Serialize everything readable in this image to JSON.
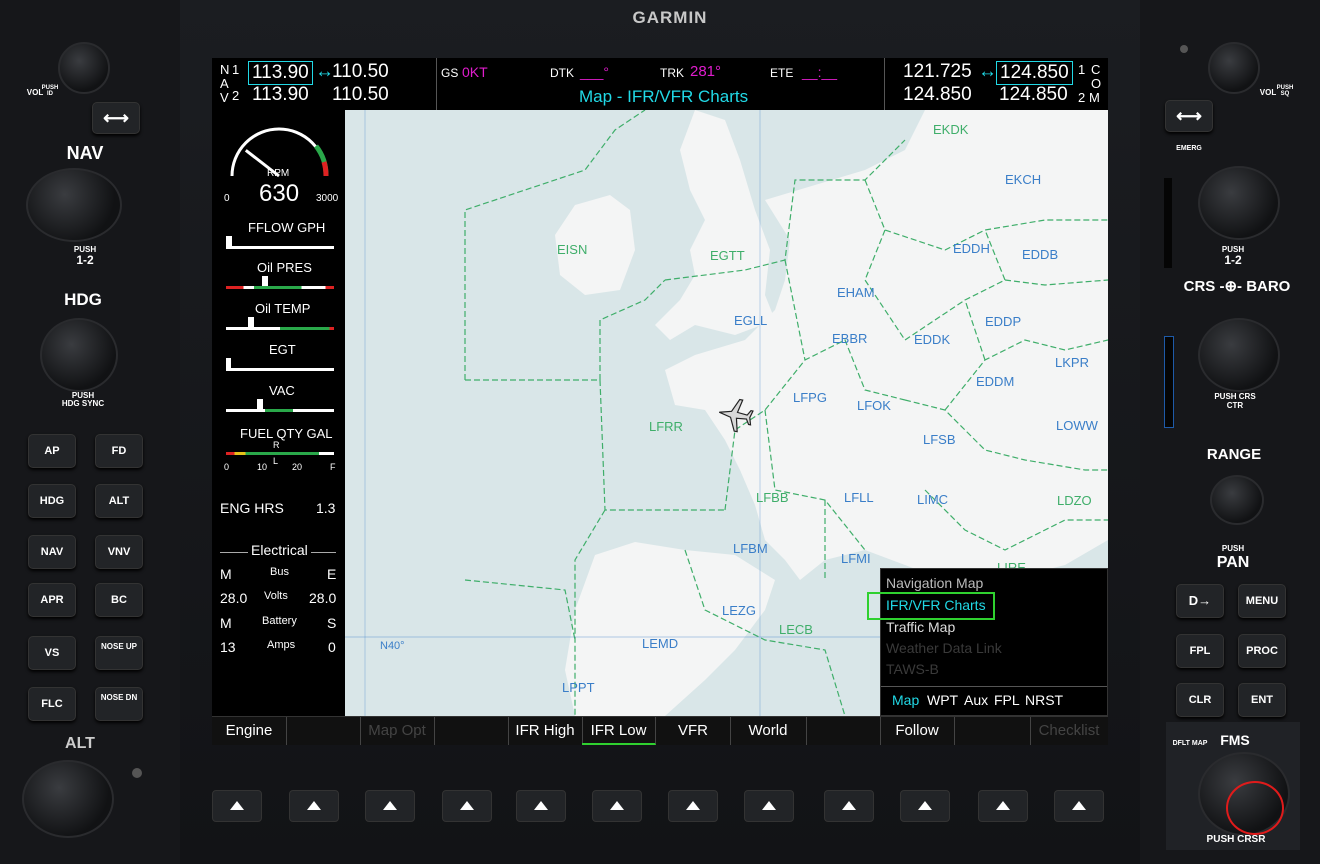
{
  "brand": "GARMIN",
  "nav": {
    "label_n": "N",
    "label_a": "A",
    "label_v": "V",
    "idx1": "1",
    "idx2": "2",
    "nav1_active": "113.90",
    "nav1_standby": "110.50",
    "nav2_active": "113.90",
    "nav2_standby": "110.50",
    "swap_arrow": "↔"
  },
  "data_fields": {
    "gs_label": "GS",
    "gs_value": "0KT",
    "dtk_label": "DTK",
    "dtk_value": "___°",
    "trk_label": "TRK",
    "trk_value": "281°",
    "ete_label": "ETE",
    "ete_value": "__:__"
  },
  "page_title": "Map - IFR/VFR Charts",
  "com": {
    "com1_active": "121.725",
    "com1_standby": "124.850",
    "com2_active": "124.850",
    "com2_standby": "124.850",
    "idx1": "1",
    "idx2": "2",
    "label_c": "C",
    "label_o": "O",
    "label_m": "M",
    "swap_arrow": "↔"
  },
  "engine": {
    "rpm_label": "RPM",
    "rpm_value": "630",
    "rpm_min": "0",
    "rpm_max": "3000",
    "fflow_label": "FFLOW GPH",
    "oil_pres_label": "Oil PRES",
    "oil_temp_label": "Oil TEMP",
    "egt_label": "EGT",
    "vac_label": "VAC",
    "fuel_label": "FUEL QTY GAL",
    "fuel_r": "R",
    "fuel_l": "L",
    "fuel_ticks": [
      "0",
      "10",
      "20",
      "F"
    ],
    "eng_hrs_label": "ENG HRS",
    "eng_hrs_value": "1.3",
    "electrical_label": "Electrical",
    "elec_m1": "M",
    "elec_bus": "Bus",
    "elec_e": "E",
    "volts_left": "28.0",
    "volts_label": "Volts",
    "volts_right": "28.0",
    "elec_m2": "M",
    "elec_battery": "Battery",
    "elec_s": "S",
    "amps_left": "13",
    "amps_label": "Amps",
    "amps_right": "0",
    "rpm_fraction": 0.21
  },
  "map": {
    "firs": [
      {
        "name": "EKDK"
      },
      {
        "name": "EISN"
      },
      {
        "name": "EGTT"
      },
      {
        "name": "LFRR"
      },
      {
        "name": "LFBB"
      },
      {
        "name": "LECB"
      },
      {
        "name": "LDZO"
      },
      {
        "name": "LIRE"
      }
    ],
    "airports": [
      {
        "name": "EKCH"
      },
      {
        "name": "EDDH"
      },
      {
        "name": "EDDB"
      },
      {
        "name": "EHAM"
      },
      {
        "name": "EGLL"
      },
      {
        "name": "EBBR"
      },
      {
        "name": "EDDK"
      },
      {
        "name": "EDDP"
      },
      {
        "name": "LKPR"
      },
      {
        "name": "EDDM"
      },
      {
        "name": "LFPG"
      },
      {
        "name": "LFOK"
      },
      {
        "name": "LOWW"
      },
      {
        "name": "LFSB"
      },
      {
        "name": "LFLL"
      },
      {
        "name": "LIMC"
      },
      {
        "name": "LFBM"
      },
      {
        "name": "LFMI"
      },
      {
        "name": "LEZG"
      },
      {
        "name": "LEMD"
      },
      {
        "name": "LPPT"
      }
    ],
    "latitude_label": "N40°"
  },
  "map_menu": {
    "items": [
      "Navigation Map",
      "IFR/VFR Charts",
      "Traffic Map",
      "Weather Data Link",
      "TAWS-B"
    ],
    "selected": "IFR/VFR Charts",
    "tabs": [
      "Map",
      "WPT",
      "Aux",
      "FPL",
      "NRST"
    ],
    "active_tab": "Map"
  },
  "softkeys": [
    "Engine",
    "",
    "Map Opt",
    "",
    "IFR High",
    "IFR Low",
    "VFR",
    "World",
    "",
    "Follow",
    "",
    "Checklist"
  ],
  "left_bezel": {
    "vol_label": "VOL",
    "vol_push": "PUSH ID",
    "nav_label": "NAV",
    "nav_push": "PUSH",
    "nav_push2": "1-2",
    "hdg_label": "HDG",
    "hdg_push": "PUSH",
    "hdg_push2": "HDG SYNC",
    "alt_label": "ALT",
    "buttons": [
      "AP",
      "FD",
      "HDG",
      "ALT",
      "NAV",
      "VNV",
      "APR",
      "BC",
      "VS",
      "NOSE UP",
      "FLC",
      "NOSE DN"
    ]
  },
  "right_bezel": {
    "vol_label": "VOL",
    "vol_push": "PUSH SQ",
    "emerg_label": "EMERG",
    "push_label": "PUSH",
    "push_12": "1-2",
    "crs_baro": "CRS -⊕- BARO",
    "push_crs_ctr": "PUSH CRS CTR",
    "range_label": "RANGE",
    "pan_push": "PUSH",
    "pan_label": "PAN",
    "buttons": [
      "D→",
      "MENU",
      "FPL",
      "PROC",
      "CLR",
      "ENT"
    ],
    "dflt_map": "DFLT MAP",
    "fms_label": "FMS",
    "push_crsr": "PUSH CRSR"
  }
}
